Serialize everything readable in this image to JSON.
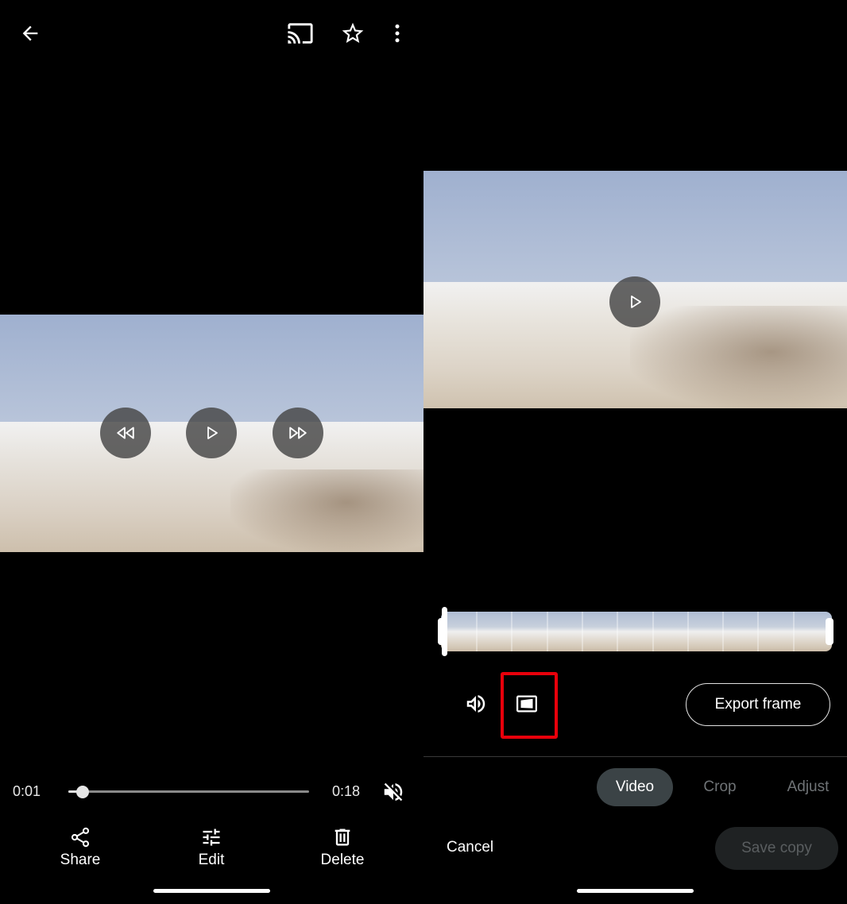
{
  "left": {
    "top_bar": {
      "back_icon": "arrow-back-icon",
      "cast_icon": "cast-icon",
      "favorite_icon": "star-outline-icon",
      "more_icon": "more-vert-icon"
    },
    "player": {
      "rewind_icon": "rewind-icon",
      "play_icon": "play-icon",
      "forward_icon": "fast-forward-icon"
    },
    "seek": {
      "current_time": "0:01",
      "total_time": "0:18",
      "progress": 0.06,
      "mute_icon": "volume-off-icon"
    },
    "actions": [
      {
        "label": "Share",
        "icon": "share-icon"
      },
      {
        "label": "Edit",
        "icon": "tune-icon"
      },
      {
        "label": "Delete",
        "icon": "trash-icon"
      }
    ]
  },
  "right": {
    "player": {
      "play_icon": "play-icon"
    },
    "tools": {
      "volume_icon": "volume-up-icon",
      "stabilize_icon": "stabilize-icon",
      "export_frame_label": "Export frame"
    },
    "tabs": [
      {
        "label": "Video",
        "active": true
      },
      {
        "label": "Crop",
        "active": false
      },
      {
        "label": "Adjust",
        "active": false
      }
    ],
    "cancel_label": "Cancel",
    "save_label": "Save copy"
  },
  "colors": {
    "background": "#000000",
    "sky": "#aebdd6",
    "ground": "#ddd6cc",
    "highlight": "#e8000b",
    "active_tab": "#3b4346"
  }
}
